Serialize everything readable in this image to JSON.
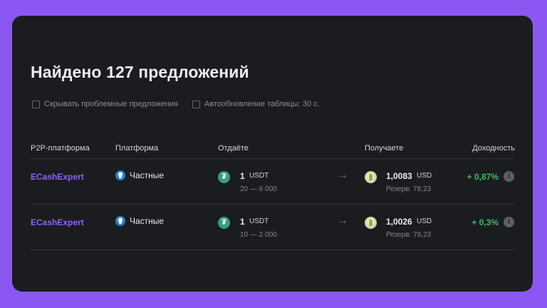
{
  "title": "Найдено 127 предложений",
  "options": [
    {
      "label": "Скрывать проблемные предложения",
      "checked": false
    },
    {
      "label": "Автообновление таблицы: 30 с.",
      "checked": false
    }
  ],
  "columns": {
    "p2p": "P2P-платформа",
    "platform": "Платформа",
    "give": "Отдаёте",
    "receive": "Получаете",
    "yield": "Доходность"
  },
  "rows": [
    {
      "p2p": "ECashExpert",
      "platform": "Частные",
      "give_amount": "1",
      "give_currency": "USDT",
      "give_limits": "20 — 6 000",
      "receive_amount": "1,0083",
      "receive_currency": "USD",
      "reserve": "Резерв: 78,23",
      "yield": "+ 0,87%"
    },
    {
      "p2p": "ECashExpert",
      "platform": "Частные",
      "give_amount": "1",
      "give_currency": "USDT",
      "give_limits": "10 — 2 000",
      "receive_amount": "1,0026",
      "receive_currency": "USD",
      "reserve": "Резерв: 78,23",
      "yield": "+ 0,3%"
    }
  ],
  "icons": {
    "platform": "private-user-icon",
    "give_coin": "tether-icon",
    "receive_coin": "usd-coin-icon",
    "arrow": "arrow-right-icon",
    "info": "info-icon"
  },
  "colors": {
    "background": "#8b57f2",
    "card": "#1b1c20",
    "link": "#8d63f3",
    "yield": "#3dbb62"
  }
}
